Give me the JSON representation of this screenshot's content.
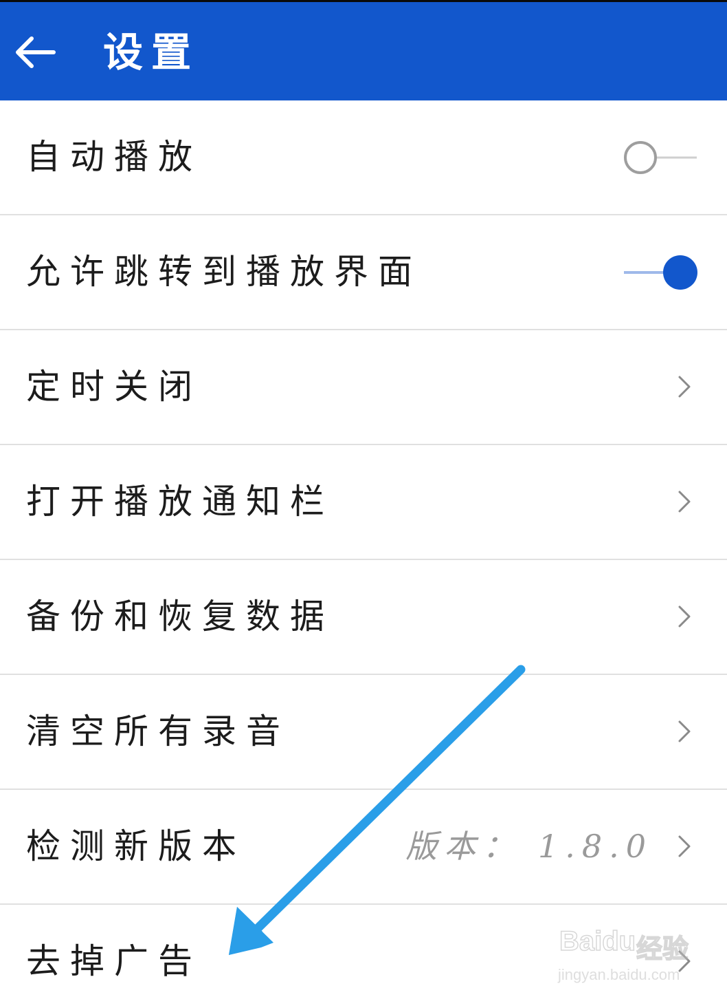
{
  "header": {
    "title": "设置",
    "back_icon": "arrow-left-icon",
    "background_color": "#1257cc"
  },
  "settings": [
    {
      "label": "自动播放",
      "control": "toggle",
      "on": false
    },
    {
      "label": "允许跳转到播放界面",
      "control": "toggle",
      "on": true
    },
    {
      "label": "定时关闭",
      "control": "chevron"
    },
    {
      "label": "打开播放通知栏",
      "control": "chevron"
    },
    {
      "label": "备份和恢复数据",
      "control": "chevron"
    },
    {
      "label": "清空所有录音",
      "control": "chevron"
    },
    {
      "label": "检测新版本",
      "control": "chevron",
      "value": "版本： 1.8.0"
    },
    {
      "label": "去掉广告",
      "control": "chevron"
    }
  ],
  "annotation": {
    "icon": "arrow-annotation-icon",
    "color": "#2a9ee8"
  },
  "watermark": {
    "brand": "Baidu",
    "sub": "经验",
    "url": "jingyan.baidu.com"
  },
  "colors": {
    "accent": "#1257cc",
    "toggle_track_on": "#9fb9ea",
    "toggle_off": "#9e9e9e",
    "divider": "#e0e0e0",
    "chevron": "#8a8a8a",
    "secondary_text": "#9a9a9a"
  }
}
